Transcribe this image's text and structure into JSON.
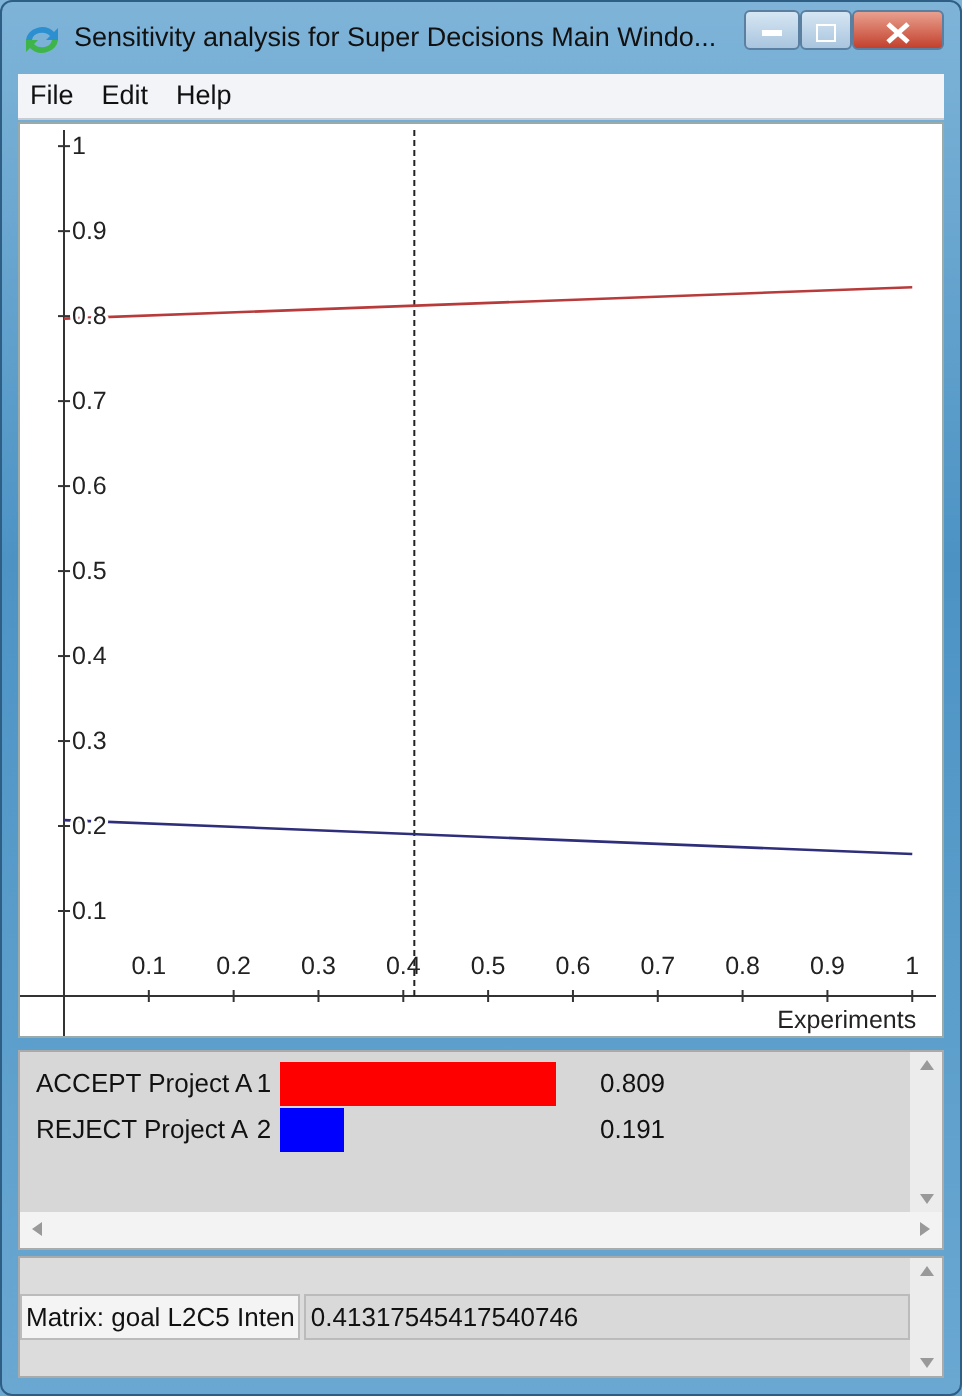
{
  "window": {
    "title": "Sensitivity analysis for Super Decisions Main Windo..."
  },
  "menu": [
    "File",
    "Edit",
    "Help"
  ],
  "chart": {
    "chart_data": {
      "type": "line",
      "xlabel": "Experiments",
      "x": [
        0,
        1
      ],
      "series": [
        {
          "color": "#b83a3a",
          "values": [
            0.797,
            0.834
          ]
        },
        {
          "color": "#2e2e7a",
          "values": [
            0.207,
            0.167
          ]
        }
      ],
      "xlim": [
        0,
        1.028
      ],
      "ylim": [
        0,
        1.019
      ],
      "xticks": [
        {
          "value": 0.1,
          "label": "0.1"
        },
        {
          "value": 0.2,
          "label": "0.2"
        },
        {
          "value": 0.3,
          "label": "0.3"
        },
        {
          "value": 0.4,
          "label": "0.4"
        },
        {
          "value": 0.5,
          "label": "0.5"
        },
        {
          "value": 0.6,
          "label": "0.6"
        },
        {
          "value": 0.7,
          "label": "0.7"
        },
        {
          "value": 0.8,
          "label": "0.8"
        },
        {
          "value": 0.9,
          "label": "0.9"
        },
        {
          "value": 1,
          "label": "1"
        }
      ],
      "yticks": [
        {
          "value": 0.1,
          "label": "0.1"
        },
        {
          "value": 0.2,
          "label": "0.2"
        },
        {
          "value": 0.3,
          "label": "0.3"
        },
        {
          "value": 0.4,
          "label": "0.4"
        },
        {
          "value": 0.5,
          "label": "0.5"
        },
        {
          "value": 0.6,
          "label": "0.6"
        },
        {
          "value": 0.7,
          "label": "0.7"
        },
        {
          "value": 0.8,
          "label": "0.8"
        },
        {
          "value": 0.9,
          "label": "0.9"
        },
        {
          "value": 1,
          "label": "1"
        }
      ],
      "ref_lines": [
        {
          "axis": "x",
          "value": 0.413
        }
      ]
    }
  },
  "results": [
    {
      "label": "ACCEPT Project A",
      "index": "1",
      "color": "#ff0000",
      "value": "0.809"
    },
    {
      "label": "REJECT Project A",
      "index": "2",
      "color": "#0000ff",
      "value": "0.191"
    }
  ],
  "status": {
    "label": "Matrix: goal L2C5 Inten",
    "value": "0.41317545417540746"
  }
}
